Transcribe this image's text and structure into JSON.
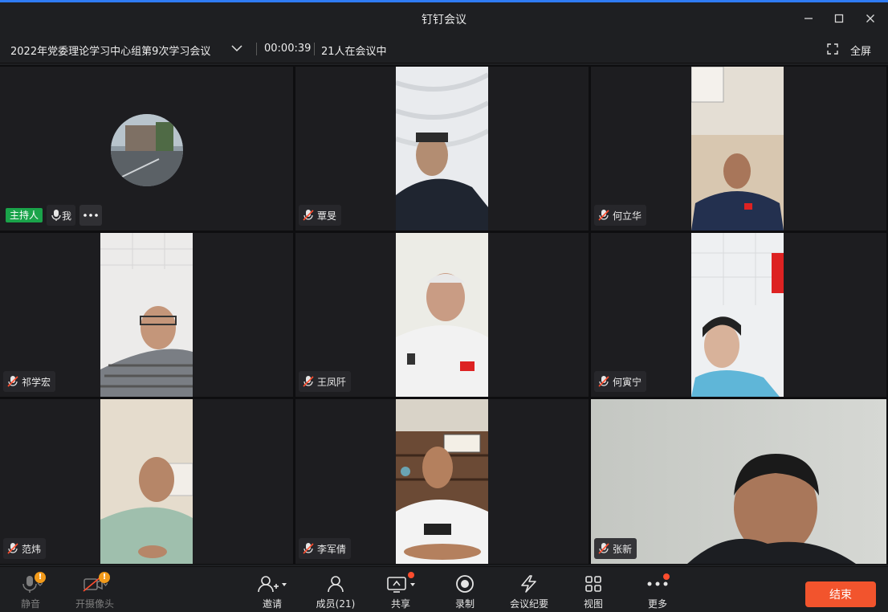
{
  "window": {
    "title": "钉钉会议",
    "accent_color": "#2f7cf6"
  },
  "infobar": {
    "meeting_title": "2022年党委理论学习中心组第9次学习会议",
    "timer": "00:00:39",
    "participants_text": "21人在会议中",
    "fullscreen_label": "全屏"
  },
  "self_tile": {
    "host_badge": "主持人",
    "me_label": "我"
  },
  "participants": [
    {
      "name": "覃旻",
      "muted": true
    },
    {
      "name": "何立华",
      "muted": true
    },
    {
      "name": "祁学宏",
      "muted": true
    },
    {
      "name": "王凤阡",
      "muted": true
    },
    {
      "name": "何寅宁",
      "muted": true
    },
    {
      "name": "范炜",
      "muted": true
    },
    {
      "name": "李军倩",
      "muted": true
    },
    {
      "name": "张新",
      "muted": true
    }
  ],
  "toolbar": {
    "mute": "静音",
    "camera": "开摄像头",
    "invite": "邀请",
    "members": "成员(21)",
    "share": "共享",
    "record": "录制",
    "minutes": "会议纪要",
    "view": "视图",
    "more": "更多",
    "end": "结束",
    "warn_badge": "!"
  },
  "colors": {
    "host_badge": "#1aa34a",
    "end_button": "#f2542d",
    "warning": "#f29a1a"
  }
}
